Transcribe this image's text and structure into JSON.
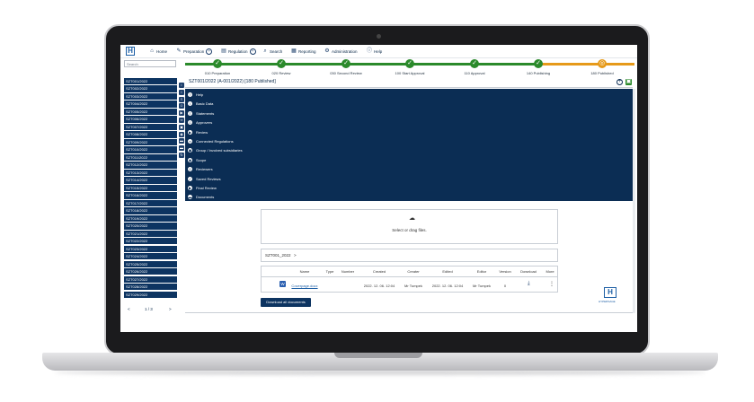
{
  "nav": {
    "items": [
      {
        "label": "Home",
        "icon": "home-icon"
      },
      {
        "label": "Preparation",
        "icon": "pencil-icon"
      },
      {
        "label": "Regulation",
        "icon": "document-icon"
      },
      {
        "label": "Search",
        "icon": "search-icon"
      },
      {
        "label": "Reporting",
        "icon": "report-icon"
      },
      {
        "label": "Administration",
        "icon": "gear-icon"
      },
      {
        "label": "Help",
        "icon": "info-icon"
      }
    ]
  },
  "search": {
    "placeholder": "Search"
  },
  "workflow": {
    "steps": [
      {
        "label": "010 Preparation",
        "status": "done"
      },
      {
        "label": "020 Review",
        "status": "done"
      },
      {
        "label": "030 Second Review",
        "status": "done"
      },
      {
        "label": "100 Start Approval",
        "status": "done"
      },
      {
        "label": "110 Approval",
        "status": "done"
      },
      {
        "label": "140 Publishing",
        "status": "done"
      },
      {
        "label": "180 Published",
        "status": "current"
      }
    ],
    "done_color": "#2b8a2b",
    "current_color": "#e69a1a"
  },
  "sidebar": {
    "items": [
      "SZT001/2022",
      "SZT002/2022",
      "SZT003/2022",
      "SZT004/2022",
      "SZT005/2022",
      "SZT006/2022",
      "SZT007/2022",
      "SZT008/2022",
      "SZT009/2022",
      "SZT010/2022",
      "SZT011/2022",
      "SZT012/2022",
      "SZT013/2022",
      "SZT014/2022",
      "SZT015/2022",
      "SZT016/2022",
      "SZT017/2022",
      "SZT018/2022",
      "SZT019/2022",
      "SZT020/2022",
      "SZT021/2022",
      "SZT022/2022",
      "SZT023/2022",
      "SZT024/2022",
      "SZT025/2022",
      "SZT026/2022",
      "SZT027/2022",
      "SZT028/2022",
      "SZT029/2022"
    ],
    "pager": {
      "prev": "<",
      "page": "1 / 3",
      "next": ">"
    }
  },
  "panel": {
    "title": "SZT001/2022 (A-001/2022) [180 Published]",
    "menu": [
      "Help",
      "Basic Data",
      "Statements",
      "Approvers",
      "Review",
      "Connected Regulations",
      "Group / Involved subsidiaries",
      "Scope",
      "Reviewers",
      "Saved Reviews",
      "Final Review",
      "Documents"
    ]
  },
  "documents": {
    "dropzone_text": "Select or drag files.",
    "breadcrumb": "SZT001_2022",
    "breadcrumb_arrow": ">",
    "columns": [
      "Name",
      "Type",
      "Number",
      "Created",
      "Creater",
      "Edited",
      "Editor",
      "Version",
      "Download",
      "More"
    ],
    "rows": [
      {
        "name": "Coverpage.docx",
        "type": "",
        "number": "",
        "created": "2022. 12. 06. 12:04",
        "creater": "Mr Tumpek",
        "edited": "2022. 12. 06. 12:04",
        "editor": "Mr Tumpek",
        "version": "0"
      }
    ],
    "download_all": "Download all documents"
  },
  "brand": {
    "text": "HYPERSAGE"
  },
  "colors": {
    "navy": "#0b2d54",
    "accent_blue": "#1d5fa5"
  }
}
